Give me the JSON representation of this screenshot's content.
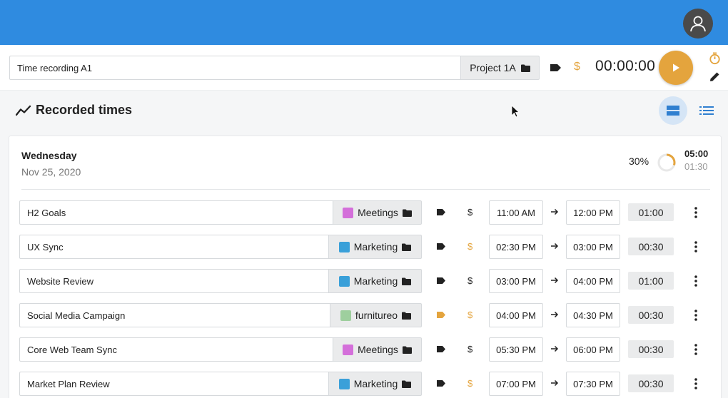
{
  "tracker": {
    "description": "Time recording A1",
    "project_label": "Project 1A",
    "timer": "00:00:00",
    "billable_symbol": "$"
  },
  "section": {
    "title": "Recorded times"
  },
  "day": {
    "name": "Wednesday",
    "date": "Nov 25, 2020",
    "percent": "30%",
    "percent_value": 30,
    "total": "05:00",
    "billable": "01:30"
  },
  "colors": {
    "header": "#2f8be0",
    "accent": "#e4a43d",
    "meetings": "#d46fda",
    "marketing": "#3aa0d9",
    "furnitureo": "#9ecf9e"
  },
  "entries": [
    {
      "description": "H2 Goals",
      "project": "Meetings",
      "color": "#d46fda",
      "billable": false,
      "tagged": false,
      "dollar": "$",
      "start": "11:00 AM",
      "end": "12:00 PM",
      "duration": "01:00"
    },
    {
      "description": "UX Sync",
      "project": "Marketing",
      "color": "#3aa0d9",
      "billable": true,
      "tagged": false,
      "dollar": "$",
      "start": "02:30 PM",
      "end": "03:00 PM",
      "duration": "00:30"
    },
    {
      "description": "Website Review",
      "project": "Marketing",
      "color": "#3aa0d9",
      "billable": false,
      "tagged": false,
      "dollar": "$",
      "start": "03:00 PM",
      "end": "04:00 PM",
      "duration": "01:00"
    },
    {
      "description": "Social Media Campaign",
      "project": "furnitureo",
      "color": "#9ecf9e",
      "billable": true,
      "tagged": true,
      "dollar": "$",
      "start": "04:00 PM",
      "end": "04:30 PM",
      "duration": "00:30"
    },
    {
      "description": "Core Web Team Sync",
      "project": "Meetings",
      "color": "#d46fda",
      "billable": false,
      "tagged": false,
      "dollar": "$",
      "start": "05:30 PM",
      "end": "06:00 PM",
      "duration": "00:30"
    },
    {
      "description": "Market Plan Review",
      "project": "Marketing",
      "color": "#3aa0d9",
      "billable": true,
      "tagged": false,
      "dollar": "$",
      "start": "07:00 PM",
      "end": "07:30 PM",
      "duration": "00:30"
    }
  ]
}
